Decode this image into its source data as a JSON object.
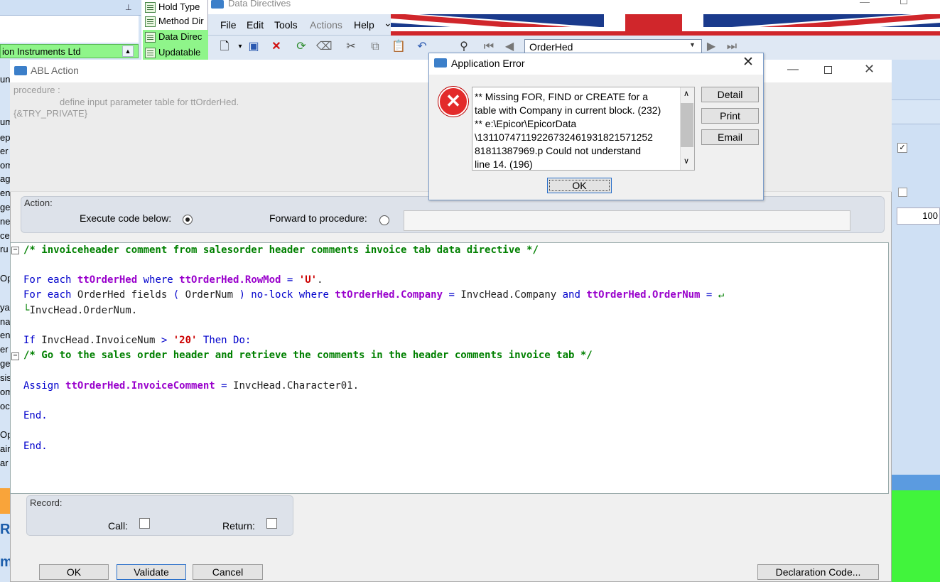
{
  "background": {
    "left_panel": {
      "selected_row": "ion Instruments Ltd",
      "strip_letters": [
        "un",
        "um",
        "ep",
        "er",
        "om",
        "ag",
        "en",
        "ge",
        "ne",
        "ce",
        "ru",
        "Op",
        "ya",
        "na",
        "en",
        "er",
        "ge",
        "sis",
        "om",
        "oc",
        "Op",
        "air",
        "ar"
      ],
      "strip_big_r": "Re",
      "strip_big_m": "m"
    },
    "tree_items": [
      "Hold Type",
      "Method Dir",
      "Data Direc",
      "Updatable"
    ],
    "right_panel": {
      "checkbox1": "✓",
      "field_value": "100"
    }
  },
  "data_directives": {
    "title": "Data Directives",
    "menu": [
      "File",
      "Edit",
      "Tools",
      "Actions",
      "Help",
      "⌄"
    ],
    "combo_value": "OrderHed"
  },
  "abl_action": {
    "title": "ABL Action",
    "procedure_lines": [
      "procedure :",
      "define input parameter table for ttOrderHed.",
      "{&TRY_PRIVATE}"
    ],
    "action_label": "Action:",
    "execute_label": "Execute code below:",
    "forward_label": "Forward to procedure:",
    "record_label": "Record:",
    "call_label": "Call:",
    "return_label": "Return:",
    "buttons": {
      "ok": "OK",
      "validate": "Validate",
      "cancel": "Cancel",
      "declaration": "Declaration Code..."
    }
  },
  "code": {
    "l1": "/* invoiceheader comment from salesorder header comments invoice tab data directive */",
    "l2_for": "For each ",
    "l2_tt": "ttOrderHed",
    "l2_where": " where ",
    "l2_rm": "ttOrderHed.RowMod",
    "l2_eq": " = ",
    "l2_str": "'U'",
    "l2_end": ".",
    "l3_for": "For each ",
    "l3_oh": "OrderHed fields ",
    "l3_p1": "( ",
    "l3_on": "OrderNum ",
    "l3_p2": ") no-lock where ",
    "l3_tc": "ttOrderHed.Company",
    "l3_eq": " = ",
    "l3_ic": "InvcHead.Company",
    "l3_and": " and ",
    "l3_to": "ttOrderHed.OrderNum",
    "l3_eq2": " = ",
    "l3_wrap": "↵",
    "l4_wrap": "└",
    "l4": "InvcHead.OrderNum.",
    "l5_if": "If ",
    "l5_in": "InvcHead.InvoiceNum",
    "l5_gt": " > ",
    "l5_str": "'20'",
    "l5_then": " Then Do:",
    "l6": "/* Go to the sales order header and retrieve the comments in the header comments invoice tab */",
    "l7_assign": "Assign ",
    "l7_tic": "ttOrderHed.InvoiceComment",
    "l7_eq": " = ",
    "l7_val": "InvcHead.Character01.",
    "l8": "End.",
    "l9": "End."
  },
  "error_dialog": {
    "title": "Application Error",
    "message_lines": [
      "** Missing FOR, FIND or CREATE for a",
      "table with Company in current block. (232)",
      "** e:\\Epicor\\EpicorData",
      "\\1311074711922673246193182157125​2",
      "81811387969.p Could not understand",
      "line 14. (196)"
    ],
    "buttons": {
      "detail": "Detail",
      "print": "Print",
      "email": "Email",
      "ok": "OK"
    }
  }
}
